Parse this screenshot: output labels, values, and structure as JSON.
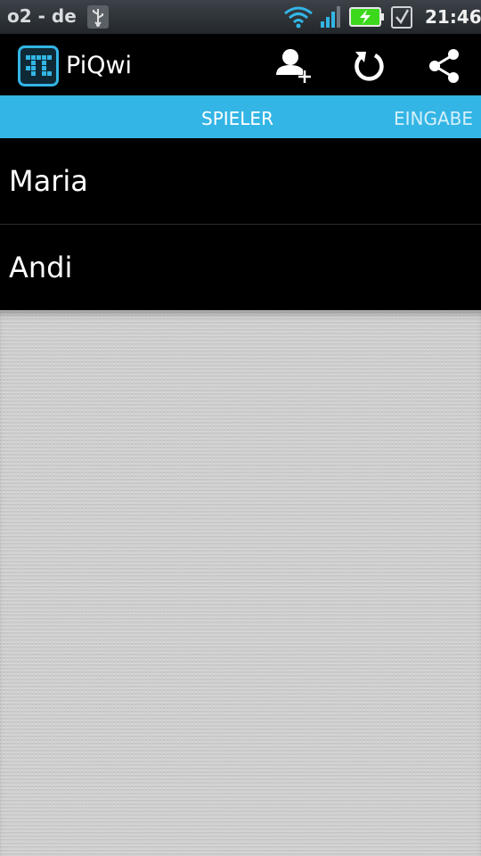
{
  "status_bar": {
    "carrier": "o2 - de",
    "time": "21:46",
    "icons": [
      "usb-icon",
      "wifi-icon",
      "signal-icon",
      "battery-charging-icon",
      "notification-check-icon"
    ]
  },
  "action_bar": {
    "title": "PiQwi",
    "actions": [
      "add-player-icon",
      "refresh-icon",
      "share-icon"
    ]
  },
  "tabs": [
    {
      "label": "SPIELER",
      "active": true
    },
    {
      "label": "EINGABE",
      "active": false
    }
  ],
  "players": [
    {
      "name": "Maria"
    },
    {
      "name": "Andi"
    }
  ],
  "colors": {
    "tab_bar": "#33b5e5",
    "action_bar": "#000000",
    "logo_accent": "#33b5e5",
    "battery_charge": "#3cd81c"
  }
}
